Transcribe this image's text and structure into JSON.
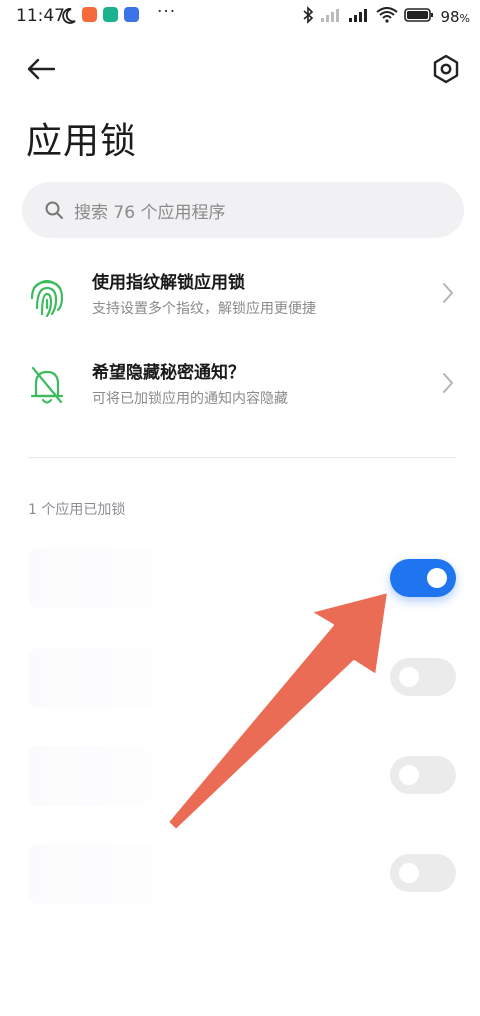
{
  "status_bar": {
    "time": "11:47",
    "dots": "···",
    "battery_text": "98",
    "battery_unit": "%"
  },
  "header": {
    "title": "应用锁"
  },
  "search": {
    "placeholder": "搜索 76 个应用程序"
  },
  "features": [
    {
      "title": "使用指纹解锁应用锁",
      "subtitle": "支持设置多个指纹，解锁应用更便捷"
    },
    {
      "title": "希望隐藏秘密通知？",
      "subtitle": "可将已加锁应用的通知内容隐藏"
    }
  ],
  "section": {
    "label": "1 个应用已加锁"
  },
  "apps": [
    {
      "locked": true
    },
    {
      "locked": false
    },
    {
      "locked": false
    },
    {
      "locked": false
    }
  ],
  "colors": {
    "accent": "#1f74f0",
    "icon_green": "#3dbb5e",
    "arrow": "#ea6c55"
  }
}
